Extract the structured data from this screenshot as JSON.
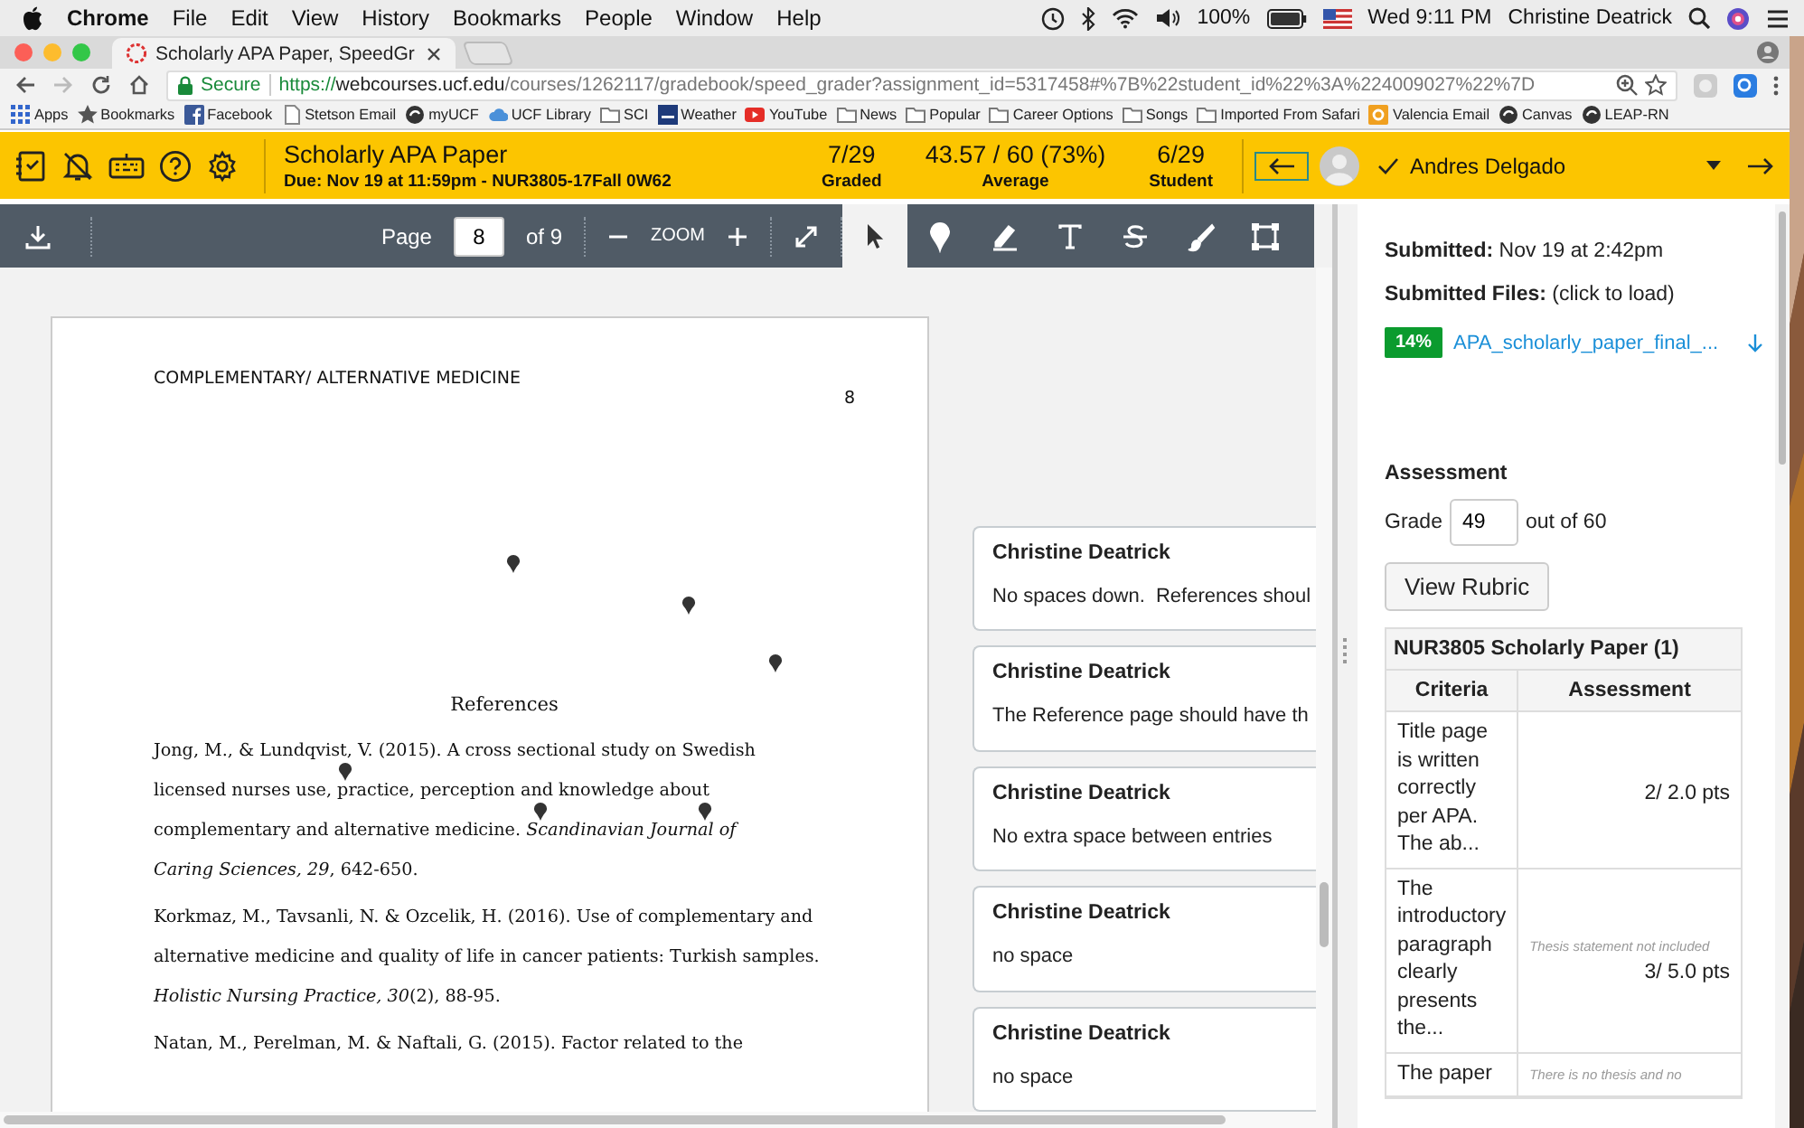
{
  "menubar": {
    "app": "Chrome",
    "menus": [
      "File",
      "Edit",
      "View",
      "History",
      "Bookmarks",
      "People",
      "Window",
      "Help"
    ],
    "battery": "100%",
    "clock": "Wed 9:11 PM",
    "user": "Christine Deatrick"
  },
  "tab": {
    "title": "Scholarly APA Paper, SpeedGr"
  },
  "address": {
    "secure": "Secure",
    "scheme": "https://",
    "host": "webcourses.ucf.edu",
    "path": "/courses/1262117/gradebook/speed_grader?assignment_id=5317458#%7B%22student_id%22%3A%224009027%22%7D"
  },
  "bookmarks": [
    {
      "label": "Apps",
      "kind": "grid"
    },
    {
      "label": "Bookmarks",
      "kind": "star"
    },
    {
      "label": "Facebook",
      "kind": "facebook"
    },
    {
      "label": "Stetson Email",
      "kind": "page"
    },
    {
      "label": "myUCF",
      "kind": "logo"
    },
    {
      "label": "UCF Library",
      "kind": "cloud"
    },
    {
      "label": "SCI",
      "kind": "folder"
    },
    {
      "label": "Weather",
      "kind": "weather"
    },
    {
      "label": "YouTube",
      "kind": "youtube"
    },
    {
      "label": "News",
      "kind": "folder"
    },
    {
      "label": "Popular",
      "kind": "folder"
    },
    {
      "label": "Career Options",
      "kind": "folder"
    },
    {
      "label": "Songs",
      "kind": "folder"
    },
    {
      "label": "Imported From Safari",
      "kind": "folder"
    },
    {
      "label": "Valencia Email",
      "kind": "valencia"
    },
    {
      "label": "Canvas",
      "kind": "logo"
    },
    {
      "label": "LEAP-RN",
      "kind": "logo"
    }
  ],
  "header": {
    "title": "Scholarly APA Paper",
    "due": "Due: Nov 19 at 11:59pm - NUR3805-17Fall 0W62",
    "stats": [
      {
        "value": "7/29",
        "label": "Graded"
      },
      {
        "value": "43.57 / 60 (73%)",
        "label": "Average"
      },
      {
        "value": "6/29",
        "label": "Student"
      }
    ],
    "student": "Andres Delgado"
  },
  "viewer": {
    "page_label": "Page",
    "page": "8",
    "page_total": "of 9",
    "zoom": "ZOOM",
    "tools": [
      {
        "kind": "pointer",
        "selected": true
      },
      {
        "kind": "pin",
        "selected": false
      },
      {
        "kind": "highlight",
        "selected": false
      },
      {
        "kind": "text",
        "selected": false
      },
      {
        "kind": "strike",
        "selected": false
      },
      {
        "kind": "brush",
        "selected": false
      },
      {
        "kind": "area",
        "selected": false
      }
    ]
  },
  "document": {
    "running_head": "COMPLEMENTARY/ ALTERNATIVE MEDICINE",
    "page_number": "8",
    "heading": "References",
    "references": [
      {
        "lines": [
          "Jong, M., & Lundqvist, V. (2015). A cross sectional study on Swedish",
          "licensed nurses use, practice, perception and knowledge about",
          "complementary and alternative medicine. *Scandinavian Journal of*",
          "*Caring Sciences, 29*, 642-650."
        ]
      },
      {
        "lines": [
          "Korkmaz, M., Tavsanli, N. & Ozcelik, H. (2016). Use of complementary and",
          "alternative medicine and quality of life in cancer patients: Turkish samples.",
          "*Holistic Nursing Practice, 30*(2), 88-95."
        ]
      },
      {
        "lines": [
          "Natan, M., Perelman, M. & Naftali, G. (2015). Factor related to the"
        ]
      }
    ]
  },
  "comments": [
    {
      "author": "Christine Deatrick",
      "text": "No spaces down.  References shoul"
    },
    {
      "author": "Christine Deatrick",
      "text": "The Reference page should have th"
    },
    {
      "author": "Christine Deatrick",
      "text": "No extra space between entries"
    },
    {
      "author": "Christine Deatrick",
      "text": "no space"
    },
    {
      "author": "Christine Deatrick",
      "text": "no space"
    }
  ],
  "submission": {
    "submitted_label": "Submitted:",
    "submitted": "Nov 19 at 2:42pm",
    "files_label": "Submitted Files:",
    "files_hint": "(click to load)",
    "file_progress": "14%",
    "file_name": "APA_scholarly_paper_final_..."
  },
  "assessment": {
    "heading": "Assessment",
    "grade_label": "Grade",
    "grade": "49",
    "out_of": "out of 60",
    "rubric_button": "View Rubric"
  },
  "rubric": {
    "title": "NUR3805 Scholarly Paper (1)",
    "columns": [
      "Criteria",
      "Assessment"
    ],
    "rows": [
      {
        "criteria": "Title page is written correctly per APA. The ab...",
        "score": "2/ 2.0 pts"
      },
      {
        "criteria": "The introductory paragraph clearly presents the...",
        "comment": "Thesis statement not included",
        "score": "3/ 5.0 pts"
      },
      {
        "criteria": "The paper",
        "comment": "There is no thesis and no"
      }
    ]
  }
}
